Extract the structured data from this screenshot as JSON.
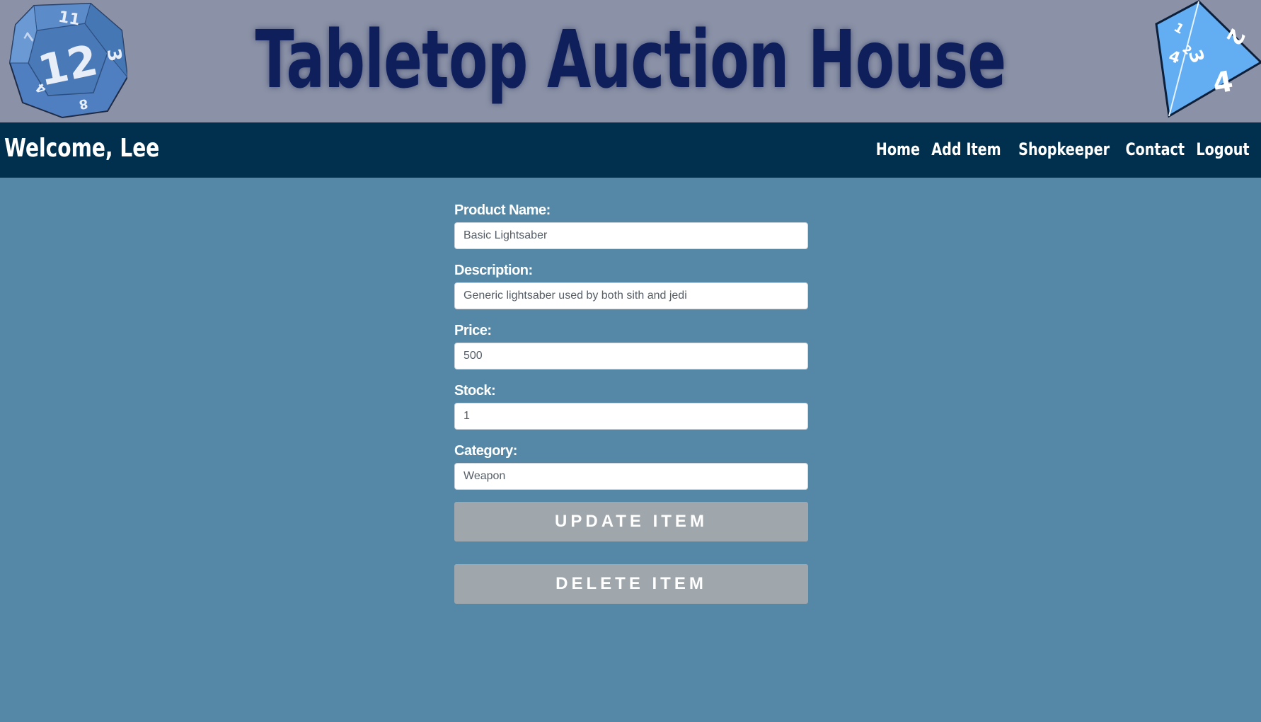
{
  "banner": {
    "title": "Tabletop Auction House",
    "left_die_icon": "d12-dice-icon",
    "right_die_icon": "d4-dice-icon"
  },
  "navbar": {
    "welcome": "Welcome, Lee",
    "links": [
      {
        "label": "Home"
      },
      {
        "label": "Add Item"
      },
      {
        "label": "Shopkeeper"
      },
      {
        "label": "Contact"
      },
      {
        "label": "Logout"
      }
    ]
  },
  "form": {
    "product_name": {
      "label": "Product Name:",
      "value": "Basic Lightsaber"
    },
    "description": {
      "label": "Description:",
      "value": "Generic lightsaber used by both sith and jedi"
    },
    "price": {
      "label": "Price:",
      "value": "500"
    },
    "stock": {
      "label": "Stock:",
      "value": "1"
    },
    "category": {
      "label": "Category:",
      "value": "Weapon"
    },
    "update_label": "Update Item",
    "delete_label": "Delete Item"
  },
  "colors": {
    "banner_bg": "#8b92a7",
    "title_color": "#0e1f5c",
    "navbar_bg": "#00304e",
    "page_bg": "#5588a6",
    "button_bg": "#a0a7ac",
    "die_left": "#4f7fc0",
    "die_right": "#63aef2"
  }
}
